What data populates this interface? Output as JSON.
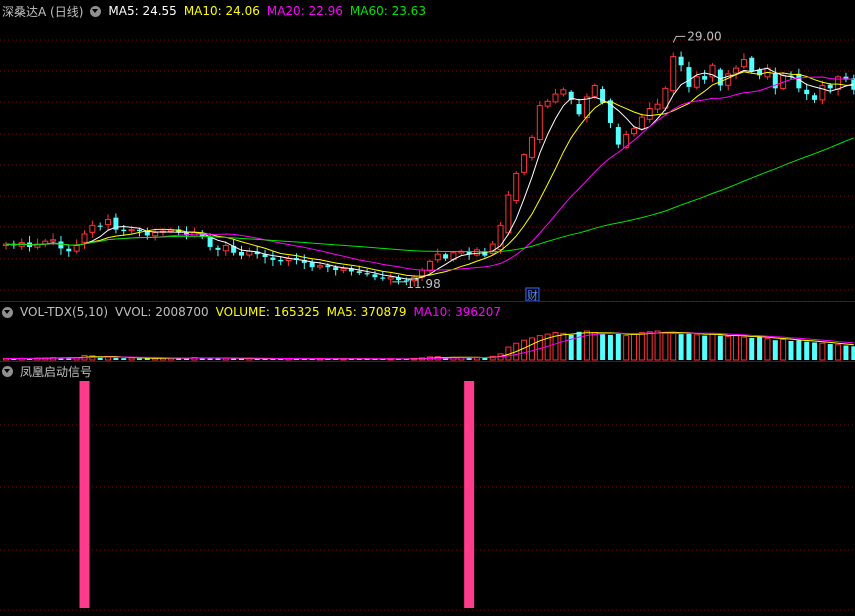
{
  "price_panel": {
    "title": "深桑达A (日线)",
    "indicators": [
      {
        "label": "MA5: 24.55",
        "color": "#ffffff"
      },
      {
        "label": "MA10: 24.06",
        "color": "#ffff00"
      },
      {
        "label": "MA20: 22.96",
        "color": "#ff00ff"
      },
      {
        "label": "MA60: 23.63",
        "color": "#00e600"
      }
    ],
    "high_marker": "29.00",
    "low_marker": "11.98",
    "finance_badge": "财"
  },
  "volume_panel": {
    "title": "VOL-TDX(5,10)",
    "indicators": [
      {
        "label": "VVOL: 2008700",
        "color": "#c0c0c0"
      },
      {
        "label": "VOLUME: 165325",
        "color": "#ffff00"
      },
      {
        "label": "MA5: 370879",
        "color": "#ffff00"
      },
      {
        "label": "MA10: 396207",
        "color": "#ff00ff"
      }
    ]
  },
  "signal_panel": {
    "title": "凤凰启动信号"
  },
  "colors": {
    "up": "#ff3232",
    "down": "#54ffff",
    "ma5": "#ffffff",
    "ma10": "#ffff00",
    "ma20": "#ff00ff",
    "ma60": "#00e600",
    "grid": "#8a0000",
    "signal": "#ff3c8c"
  },
  "chart_data": [
    {
      "type": "candlestick",
      "title": "深桑达A (日线)",
      "series_close": [
        14.6,
        14.5,
        14.7,
        14.4,
        14.6,
        14.8,
        14.9,
        14.3,
        14.1,
        14.5,
        15.3,
        15.9,
        15.8,
        16.3,
        15.6,
        15.5,
        15.6,
        15.5,
        15.2,
        15.4,
        15.5,
        15.6,
        15.4,
        15.2,
        15.4,
        15.1,
        14.4,
        14.2,
        14.5,
        14.0,
        13.8,
        14.1,
        13.9,
        13.7,
        13.5,
        13.4,
        13.6,
        13.5,
        13.3,
        13.0,
        13.1,
        13.0,
        12.8,
        12.9,
        12.7,
        12.6,
        12.5,
        12.3,
        12.2,
        12.3,
        12.1,
        12.0,
        12.3,
        12.8,
        13.4,
        13.9,
        13.6,
        14.0,
        14.1,
        13.9,
        14.2,
        13.8,
        14.6,
        15.9,
        18.0,
        19.5,
        20.8,
        22.0,
        24.2,
        24.5,
        25.0,
        25.3,
        24.6,
        23.6,
        24.8,
        25.6,
        24.4,
        23.0,
        21.5,
        22.2,
        22.6,
        23.4,
        24.0,
        24.3,
        25.4,
        27.6,
        27.0,
        25.5,
        26.2,
        26.0,
        27.0,
        25.6,
        26.4,
        26.8,
        27.4,
        26.6,
        26.3,
        26.8,
        25.4,
        26.3,
        26.2,
        25.4,
        25.0,
        24.6,
        25.6,
        25.4,
        26.2,
        26.0,
        25.3
      ]
    },
    {
      "type": "bar",
      "title": "VOL-TDX(5,10)",
      "series": [
        {
          "name": "VOLUME",
          "values": [
            0.1,
            0.09,
            0.11,
            0.1,
            0.12,
            0.13,
            0.15,
            0.17,
            0.16,
            0.14,
            0.3,
            0.28,
            0.2,
            0.22,
            0.14,
            0.12,
            0.13,
            0.11,
            0.1,
            0.11,
            0.12,
            0.13,
            0.12,
            0.11,
            0.16,
            0.15,
            0.12,
            0.12,
            0.11,
            0.1,
            0.1,
            0.11,
            0.1,
            0.09,
            0.09,
            0.08,
            0.09,
            0.08,
            0.08,
            0.09,
            0.09,
            0.08,
            0.08,
            0.08,
            0.07,
            0.08,
            0.08,
            0.07,
            0.07,
            0.08,
            0.07,
            0.07,
            0.1,
            0.14,
            0.2,
            0.22,
            0.18,
            0.16,
            0.16,
            0.17,
            0.18,
            0.17,
            0.24,
            0.4,
            0.85,
            1.1,
            1.3,
            1.45,
            1.6,
            1.7,
            1.8,
            1.75,
            1.65,
            1.85,
            1.9,
            1.8,
            1.7,
            1.65,
            1.75,
            1.6,
            1.7,
            1.8,
            1.85,
            1.9,
            1.8,
            1.75,
            1.7,
            1.8,
            1.65,
            1.6,
            1.7,
            1.6,
            1.55,
            1.6,
            1.5,
            1.45,
            1.55,
            1.4,
            1.3,
            1.35,
            1.25,
            1.3,
            1.2,
            1.15,
            1.1,
            1.05,
            1.0,
            0.95,
            0.9
          ]
        }
      ]
    },
    {
      "type": "bar",
      "title": "凤凰启动信号",
      "signal_days": [
        10,
        59
      ]
    }
  ]
}
